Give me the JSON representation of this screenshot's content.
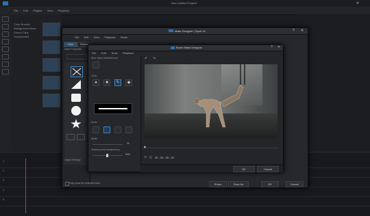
{
  "app": {
    "window_title": "New Untitled Project*",
    "menu": [
      "File",
      "Edit",
      "Plugins",
      "View",
      "Playback"
    ],
    "library_items": [
      "Color Boards",
      "Background Music",
      "Sound Clips",
      "Downloaded"
    ]
  },
  "mask_window": {
    "title": "Mask Designer | Sport 01",
    "menu": [
      "File",
      "Edit",
      "View",
      "Playback",
      "Share"
    ],
    "tabs": [
      "Mask",
      "Shadow"
    ],
    "section_mask_properties": "Mask Properties",
    "section_object_settings": "Object Settings",
    "checkbox_label": "Only show the selected track",
    "buttons": [
      "Share",
      "Save As",
      "OK",
      "Cancel"
    ]
  },
  "brush_window": {
    "title": "Brush Mask Designer",
    "menu": [
      "File",
      "Edit",
      "Tools",
      "Playback"
    ],
    "label_tools": "Tools",
    "label_object_selection": "Auto object selection tool",
    "label_mode": "Mode",
    "label_width": "Width",
    "label_transparency": "Starting point transparency",
    "width_value": "20",
    "transparency_value": "50%",
    "timecode": "00 ; 00 ; 00 ; 00",
    "buttons": [
      "OK",
      "Cancel"
    ]
  },
  "colors": {
    "accent": "#3d86c6",
    "playhead": "#c23b3b",
    "clip": "#4e9bb0"
  }
}
